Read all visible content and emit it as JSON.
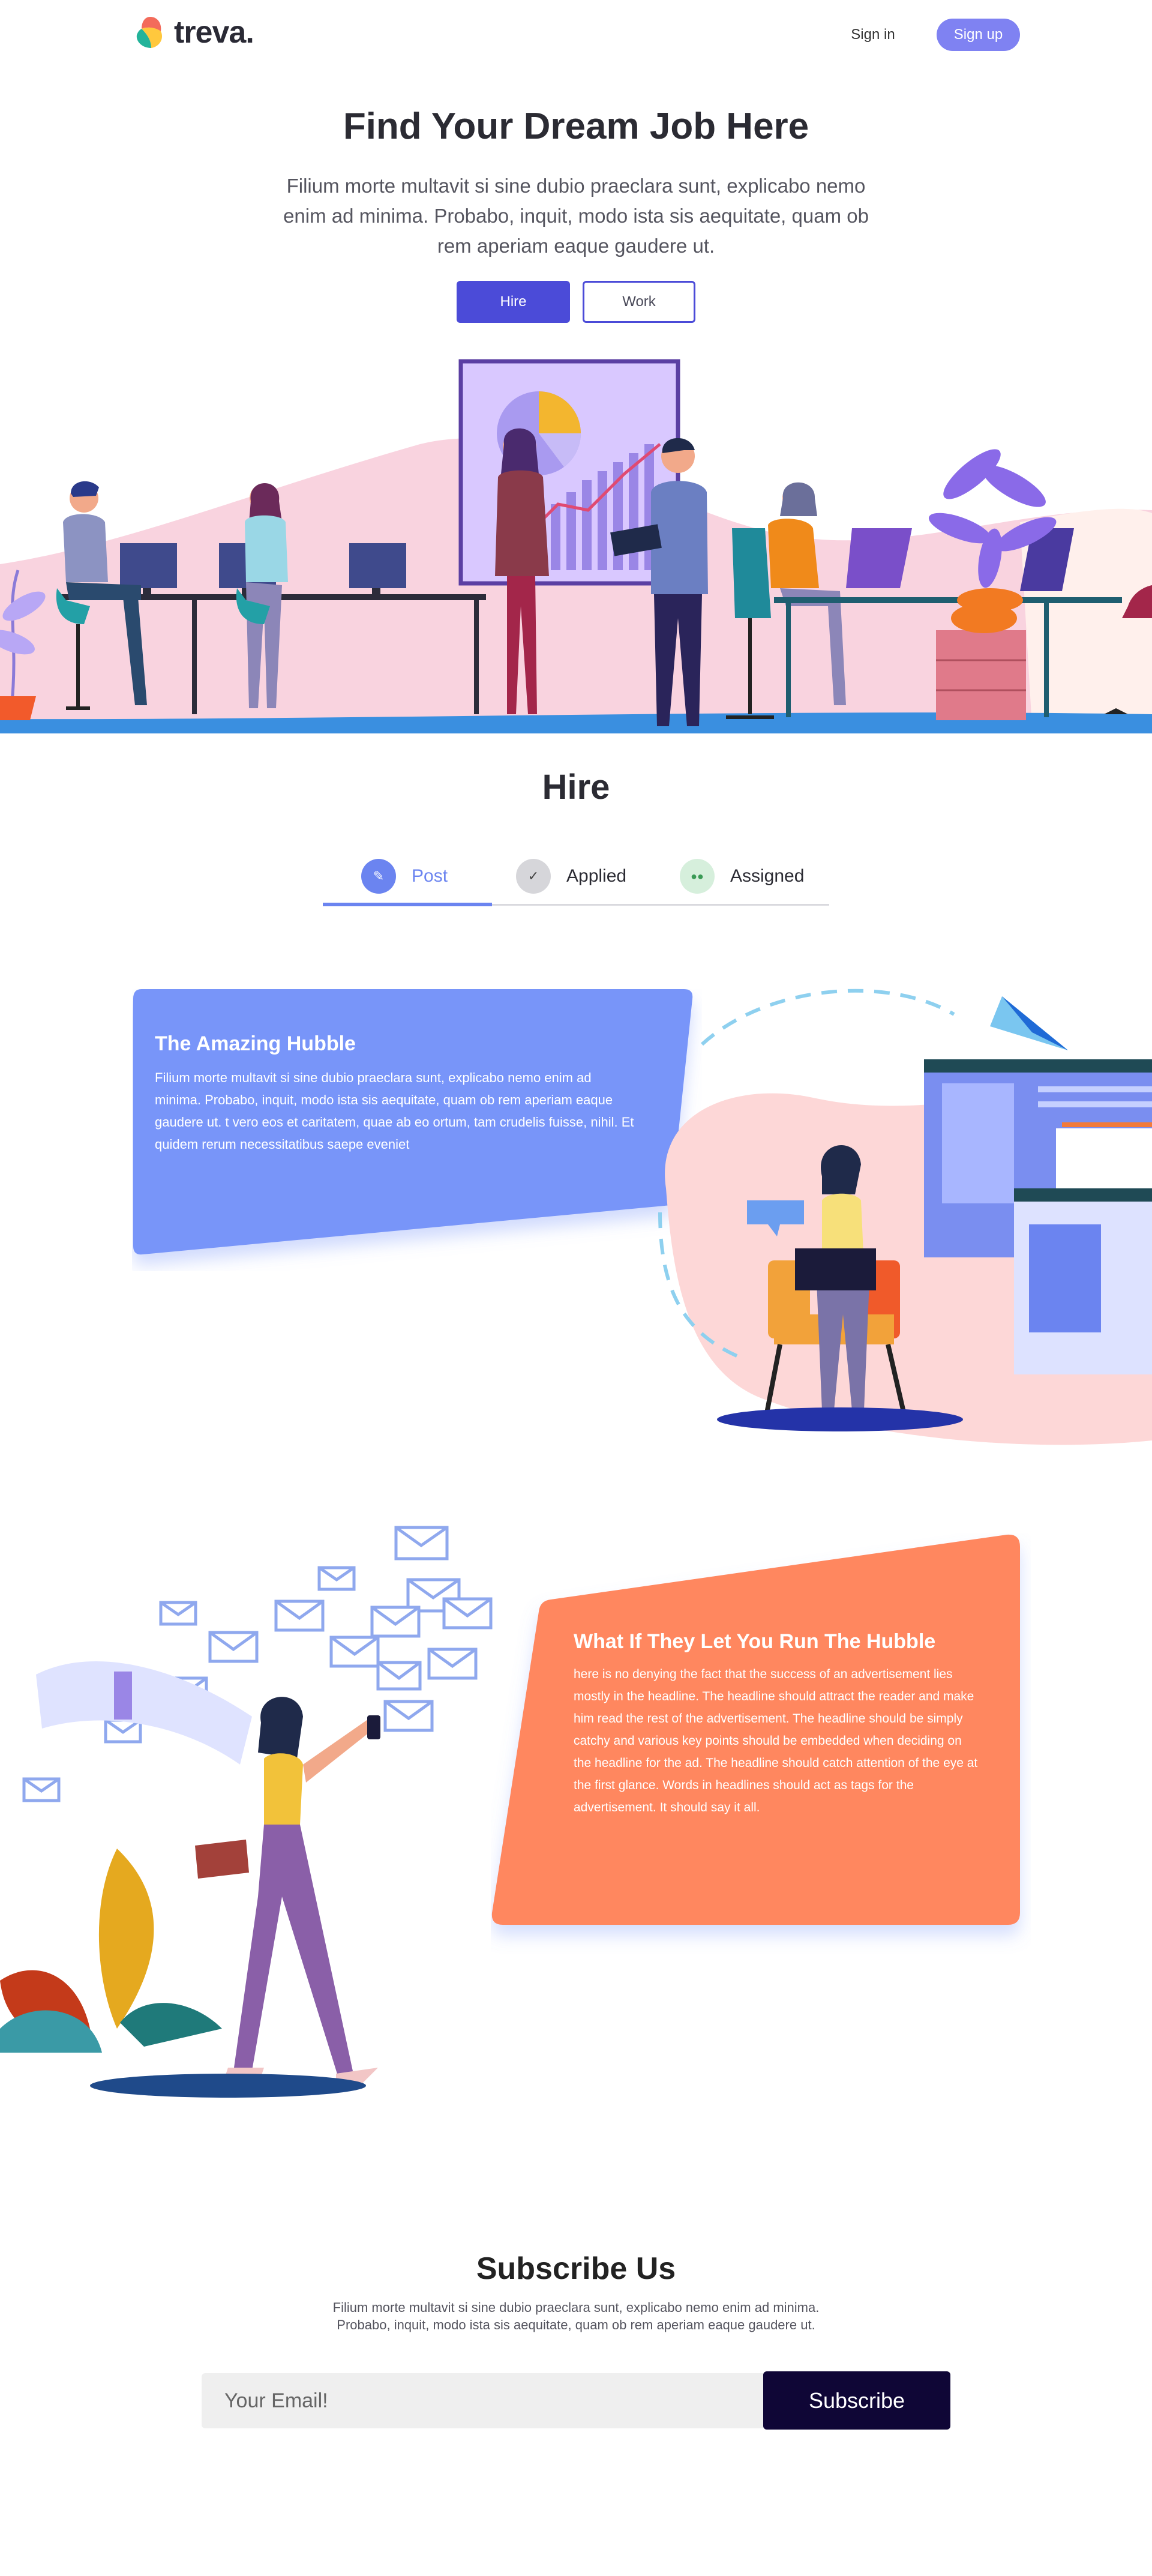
{
  "header": {
    "logo_text": "treva.",
    "sign_in": "Sign in",
    "sign_up": "Sign up"
  },
  "hero": {
    "title": "Find Your Dream Job Here",
    "subtitle": "Filium morte multavit si sine dubio praeclara sunt, explicabo nemo enim ad minima. Probabo, inquit, modo ista sis aequitate, quam ob rem aperiam eaque gaudere ut.",
    "buttons": {
      "hire": "Hire",
      "work": "Work"
    }
  },
  "hire": {
    "title": "Hire",
    "tabs": [
      {
        "label": "Post",
        "icon": "pencil-icon",
        "active": true,
        "color": "#6b84f0"
      },
      {
        "label": "Applied",
        "icon": "check-icon",
        "active": false,
        "color": "#d6d6da"
      },
      {
        "label": "Assigned",
        "icon": "users-icon",
        "active": false,
        "color": "#d6efdc"
      }
    ],
    "feature_1": {
      "title": "The Amazing Hubble",
      "body": "Filium morte multavit si sine dubio praeclara sunt, explicabo nemo enim ad minima. Probabo, inquit, modo ista sis aequitate, quam ob rem aperiam eaque gaudere ut. t vero eos et caritatem, quae ab eo ortum, tam crudelis fuisse, nihil. Et quidem rerum necessitatibus saepe eveniet",
      "color": "#7895f9"
    },
    "feature_2": {
      "title": "What If They Let You Run The Hubble",
      "body": "here is no denying the fact that the success of an advertisement lies mostly in the headline. The headline should attract the reader and make him read the rest of the advertisement. The headline should be simply catchy and various key points should be embedded when deciding on the headline for the ad. The headline should catch attention of the eye at the first glance. Words in headlines should act as tags for the advertisement. It should say it all.",
      "color": "#ff875e"
    }
  },
  "subscribe": {
    "title": "Subscribe Us",
    "text": "Filium morte multavit si sine dubio praeclara sunt, explicabo nemo enim ad minima. Probabo, inquit, modo ista sis aequitate, quam ob rem aperiam eaque gaudere ut.",
    "email_placeholder": "Your Email!",
    "button": "Subscribe"
  },
  "colors": {
    "accent": "#7f82f2",
    "primary_button": "#4b4bd8",
    "subscribe_button": "#0f0636"
  }
}
